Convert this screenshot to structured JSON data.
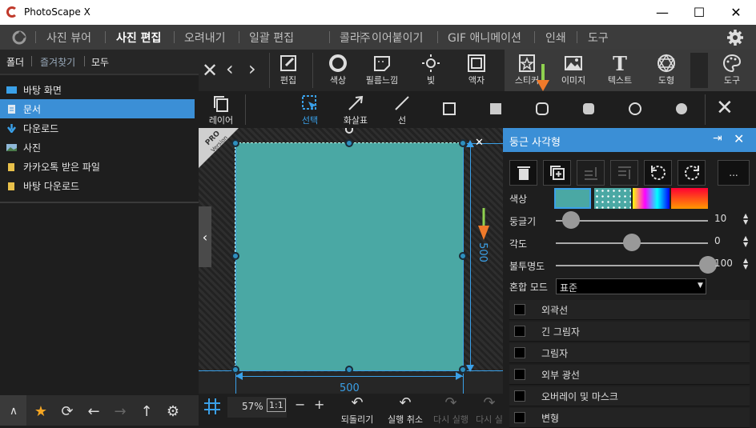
{
  "window": {
    "title": "PhotoScape X",
    "minimize": "—",
    "maximize": "☐",
    "close": "✕"
  },
  "menu": {
    "items": [
      "사진 뷰어",
      "사진 편집",
      "오려내기",
      "일괄 편집",
      "콜라주",
      "이어붙이기",
      "GIF 애니메이션",
      "인쇄",
      "도구"
    ],
    "active": "사진 편집"
  },
  "left_panel": {
    "tabs": [
      "폴더",
      "즐겨찾기",
      "모두"
    ],
    "active_tab": "즐겨찾기",
    "favorites": [
      "바탕 화면",
      "문서",
      "다운로드",
      "사진",
      "카카오톡 받은 파일",
      "바탕 다운로드"
    ],
    "selected": "문서"
  },
  "toolbar": {
    "tools": [
      "편집",
      "색상",
      "필름느낌",
      "빛",
      "액자",
      "스티커",
      "이미지",
      "텍스트",
      "도형",
      "도구"
    ]
  },
  "toolbar2": {
    "layer": "레이어",
    "select": "선택",
    "arrow": "화살표",
    "line": "선"
  },
  "canvas": {
    "pro_badge_main": "PRO",
    "pro_badge_sub": "Version",
    "dim_height": "500",
    "dim_width": "500",
    "shape_color": "#4aa8a4"
  },
  "bottom": {
    "zoom": "57%",
    "one_to_one": "1:1",
    "undo_all": "되돌리기",
    "undo": "실행 취소",
    "redo": "다시 실행",
    "redo_all": "다시 실"
  },
  "panel": {
    "title": "둥근 사각형",
    "more": "...",
    "color_label": "색상",
    "roundness_label": "둥글기",
    "roundness_value": "10",
    "roundness_level": 0.1,
    "angle_label": "각도",
    "angle_value": "0",
    "angle_level": 0.5,
    "opacity_label": "불투명도",
    "opacity_value": "100",
    "opacity_level": 1.0,
    "blend_label": "혼합 모드",
    "blend_value": "표준",
    "options": [
      "외곽선",
      "긴 그림자",
      "그림자",
      "외부 광선",
      "오버레이 및 마스크",
      "변형"
    ]
  },
  "colors": {
    "accent": "#3b8fd6",
    "shape": "#4aa8a4",
    "handle": "#2e8fbf",
    "arrow": "#f07a2a"
  }
}
